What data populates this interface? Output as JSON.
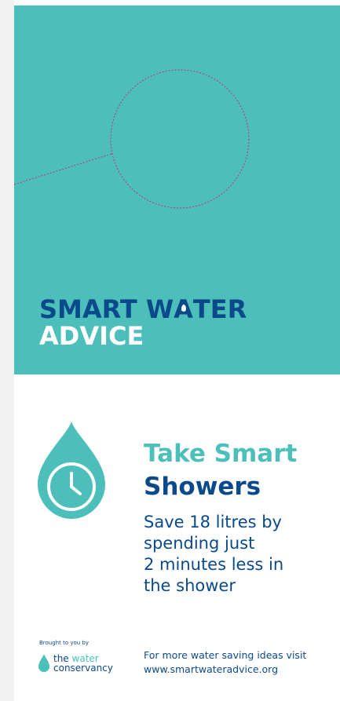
{
  "brand": {
    "logo_line1_pre": "SMART W",
    "logo_line1_a": "A",
    "logo_line1_post": "TER",
    "logo_line2": "ADVICE"
  },
  "tip": {
    "heading_line1": "Take Smart",
    "heading_line2": "Showers",
    "body_lines": [
      "Save 18 litres by",
      "spending just",
      "2 minutes less in",
      "the shower"
    ]
  },
  "sponsor": {
    "brought_by": "Brought to you by",
    "name_the": "the",
    "name_water": "water",
    "name_conservancy": "conservancy"
  },
  "footer": {
    "line1": "For more water saving ideas visit",
    "url": "www.smartwateradvice.org"
  },
  "icons": {
    "drop": "water-drop-clock-icon",
    "sponsor_drop": "water-drop-icon"
  },
  "colors": {
    "teal": "#4cbfbb",
    "navy": "#0b4a8a",
    "guide_magenta": "#c2307f"
  }
}
